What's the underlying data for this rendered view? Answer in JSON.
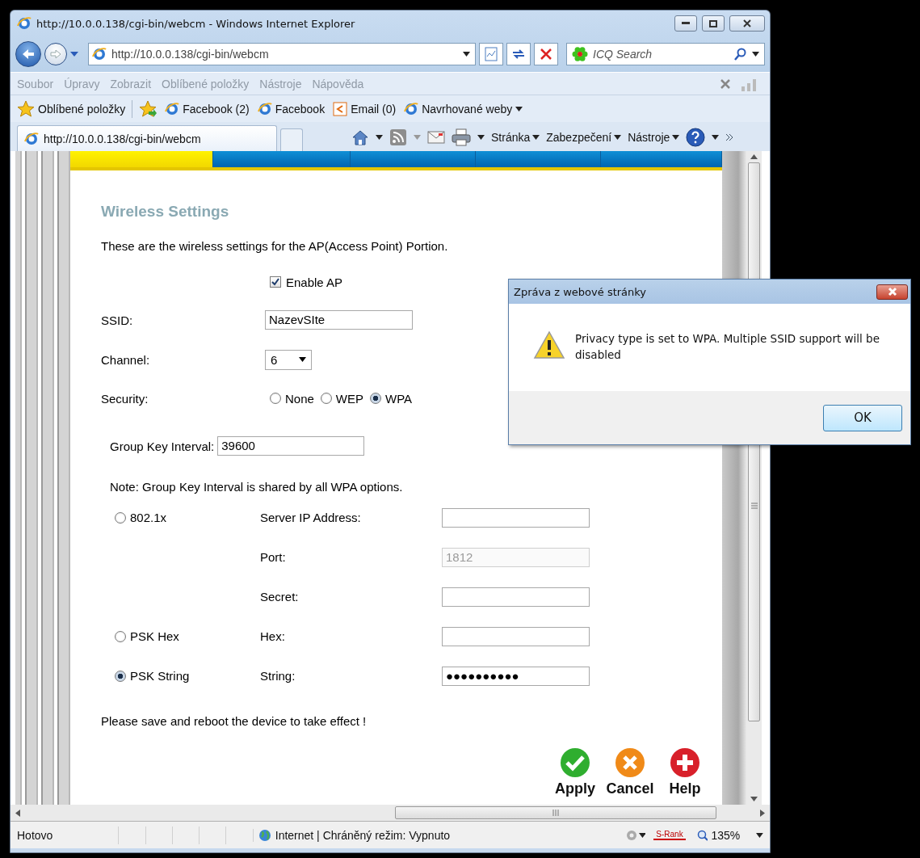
{
  "browser": {
    "title": "http://10.0.0.138/cgi-bin/webcm - Windows Internet Explorer",
    "address": "http://10.0.0.138/cgi-bin/webcm",
    "search_placeholder": "ICQ Search"
  },
  "menu": [
    "Soubor",
    "Úpravy",
    "Zobrazit",
    "Oblíbené položky",
    "Nástroje",
    "Nápověda"
  ],
  "favorites": [
    {
      "kind": "favorites",
      "label": "Oblíbené položky"
    },
    {
      "kind": "add"
    },
    {
      "kind": "page",
      "label": "Facebook (2)"
    },
    {
      "kind": "page",
      "label": "Facebook"
    },
    {
      "kind": "mail",
      "label": "Email (0)"
    },
    {
      "kind": "suggested",
      "label": "Navrhované weby"
    }
  ],
  "tab": {
    "title": "http://10.0.0.138/cgi-bin/webcm"
  },
  "commands": [
    {
      "kind": "home"
    },
    {
      "kind": "feeds"
    },
    {
      "kind": "mail"
    },
    {
      "kind": "print"
    },
    {
      "kind": "menu",
      "label": "Stránka"
    },
    {
      "kind": "menu",
      "label": "Zabezpečení"
    },
    {
      "kind": "menu",
      "label": "Nástroje"
    },
    {
      "kind": "help"
    }
  ],
  "nav_tabs": [
    {
      "selected": true
    },
    {
      "selected": false
    },
    {
      "selected": false
    },
    {
      "selected": false
    },
    {
      "selected": false
    }
  ],
  "page": {
    "title": "Wireless Settings",
    "intro": "These are the wireless settings for the AP(Access Point) Portion.",
    "enable_ap": {
      "label": "Enable AP",
      "checked": true
    },
    "ssid": {
      "label": "SSID:",
      "value": "NazevSIte"
    },
    "channel": {
      "label": "Channel:",
      "value": "6"
    },
    "security": {
      "label": "Security:",
      "options": [
        {
          "label": "None",
          "selected": false
        },
        {
          "label": "WEP",
          "selected": false
        },
        {
          "label": "WPA",
          "selected": true
        }
      ]
    },
    "group_key": {
      "label": "Group Key Interval:",
      "value": "39600"
    },
    "note": "Note: Group Key Interval is shared by all WPA options.",
    "wpa_options": [
      {
        "label": "802.1x",
        "selected": false,
        "fields": [
          {
            "label": "Server IP Address:",
            "disabled": false
          },
          {
            "label": "Port:",
            "value": "1812",
            "disabled": true
          },
          {
            "label": "Secret:",
            "disabled": false
          }
        ]
      },
      {
        "label": "PSK Hex",
        "selected": false,
        "fields": [
          {
            "label": "Hex:",
            "disabled": false
          }
        ]
      },
      {
        "label": "PSK String",
        "selected": true,
        "fields": [
          {
            "label": "String:",
            "value": "●●●●●●●●●●",
            "disabled": false
          }
        ]
      }
    ],
    "footer": "Please save and reboot the device to take effect !",
    "actions": [
      {
        "kind": "apply",
        "label": "Apply"
      },
      {
        "kind": "cancel",
        "label": "Cancel"
      },
      {
        "kind": "help",
        "label": "Help"
      }
    ]
  },
  "status_bar": {
    "status": "Hotovo",
    "zone": "Internet | Chráněný režim: Vypnuto",
    "addon": "S-Rank",
    "zoom": "135%"
  },
  "dialog": {
    "title": "Zpráva z webové stránky",
    "message": "Privacy type is set to WPA. Multiple SSID support will be disabled",
    "button": "OK"
  }
}
